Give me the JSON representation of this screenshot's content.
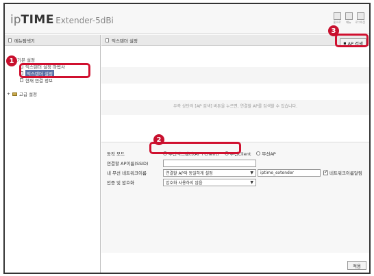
{
  "header": {
    "logo_ip": "ip",
    "logo_time": "TIME",
    "logo_ext": "Extender-5dBi",
    "icons": [
      {
        "name": "home-icon",
        "label": "홈으로"
      },
      {
        "name": "help-icon",
        "label": "매뉴"
      },
      {
        "name": "logout-icon",
        "label": "로그아웃"
      }
    ]
  },
  "sidebar": {
    "title": "메뉴탐색기",
    "basic_settings": "기본 설정",
    "wireless_setup": "익스텐더 설정 마법사",
    "extender_setup": "익스텐더 설정",
    "network_info": "현재 연결 정보",
    "advanced_settings": "고급 설정"
  },
  "main": {
    "title": "익스텐더 설정",
    "ap_search_button": "AP 검색",
    "ap_message": "우측 상단의 [AP 검색] 버튼을 누르면, 연결할 AP를 검색할 수 있습니다.",
    "apply_button": "적용"
  },
  "settings": {
    "mode_label": "동작 모드",
    "mode_options": [
      "무선익스텐더(AP+Client)",
      "무선Client",
      "무선AP"
    ],
    "ssid_label": "연결할 AP이름(SSID)",
    "ssid_value": "",
    "network_label": "내 무선 네트워크이름",
    "network_select": "연결할 AP와 동일하게 설정",
    "network_value": "iptime_extender",
    "broadcast_label": "네트워크이름알림",
    "auth_label": "인증 및 암호화",
    "auth_select": "암호화 사용하지 않음"
  },
  "annotations": {
    "m1": "1",
    "m2": "2",
    "m3": "3"
  }
}
